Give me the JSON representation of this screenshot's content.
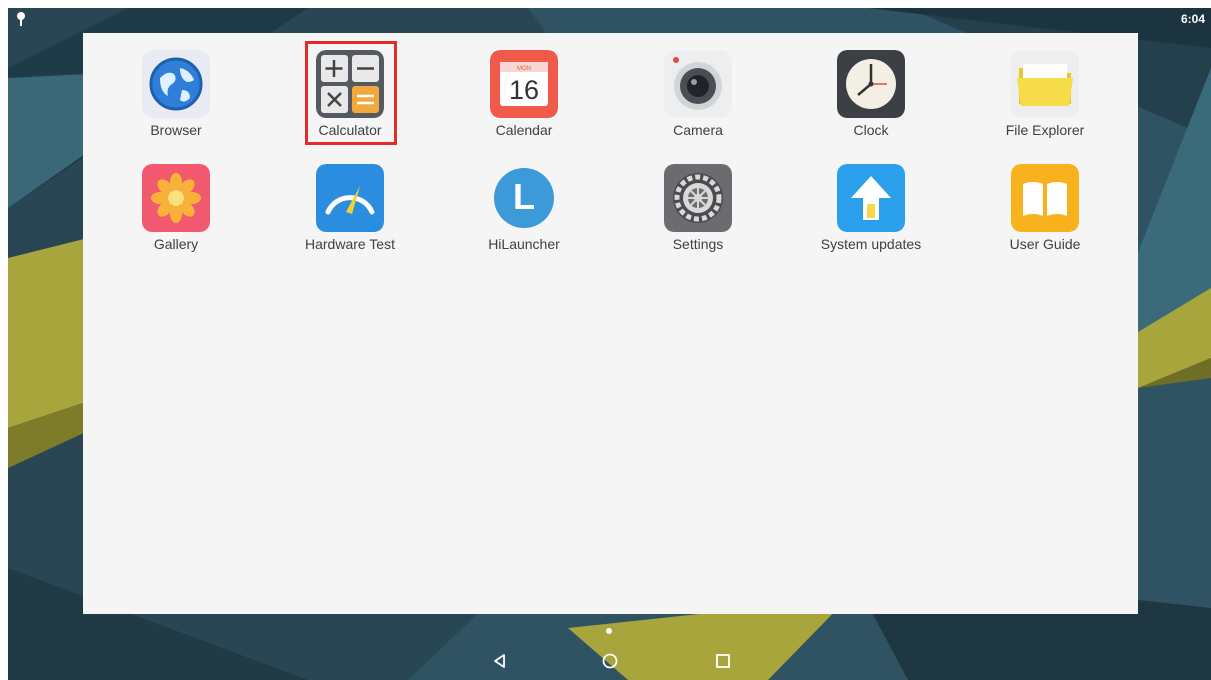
{
  "status_bar": {
    "time": "6:04",
    "notification_icon": "map-pin-icon"
  },
  "apps": [
    {
      "label": "Browser",
      "icon": "globe-icon"
    },
    {
      "label": "Calculator",
      "icon": "calculator-icon"
    },
    {
      "label": "Calendar",
      "icon": "calendar-icon",
      "icon_text": "16"
    },
    {
      "label": "Camera",
      "icon": "camera-icon"
    },
    {
      "label": "Clock",
      "icon": "clock-icon"
    },
    {
      "label": "File Explorer",
      "icon": "folder-icon"
    },
    {
      "label": "Gallery",
      "icon": "flower-icon"
    },
    {
      "label": "Hardware Test",
      "icon": "speedometer-icon"
    },
    {
      "label": "HiLauncher",
      "icon": "launcher-l-icon",
      "icon_text": "L"
    },
    {
      "label": "Settings",
      "icon": "gear-icon"
    },
    {
      "label": "System updates",
      "icon": "arrow-up-icon"
    },
    {
      "label": "User Guide",
      "icon": "book-icon"
    }
  ],
  "highlighted_app": "Calculator",
  "highlight_color": "#e52c2c",
  "page_indicator": {
    "pages": 1,
    "current": 1
  },
  "nav_bar": {
    "back": "back-triangle-icon",
    "home": "home-circle-icon",
    "recents": "recents-square-icon"
  }
}
